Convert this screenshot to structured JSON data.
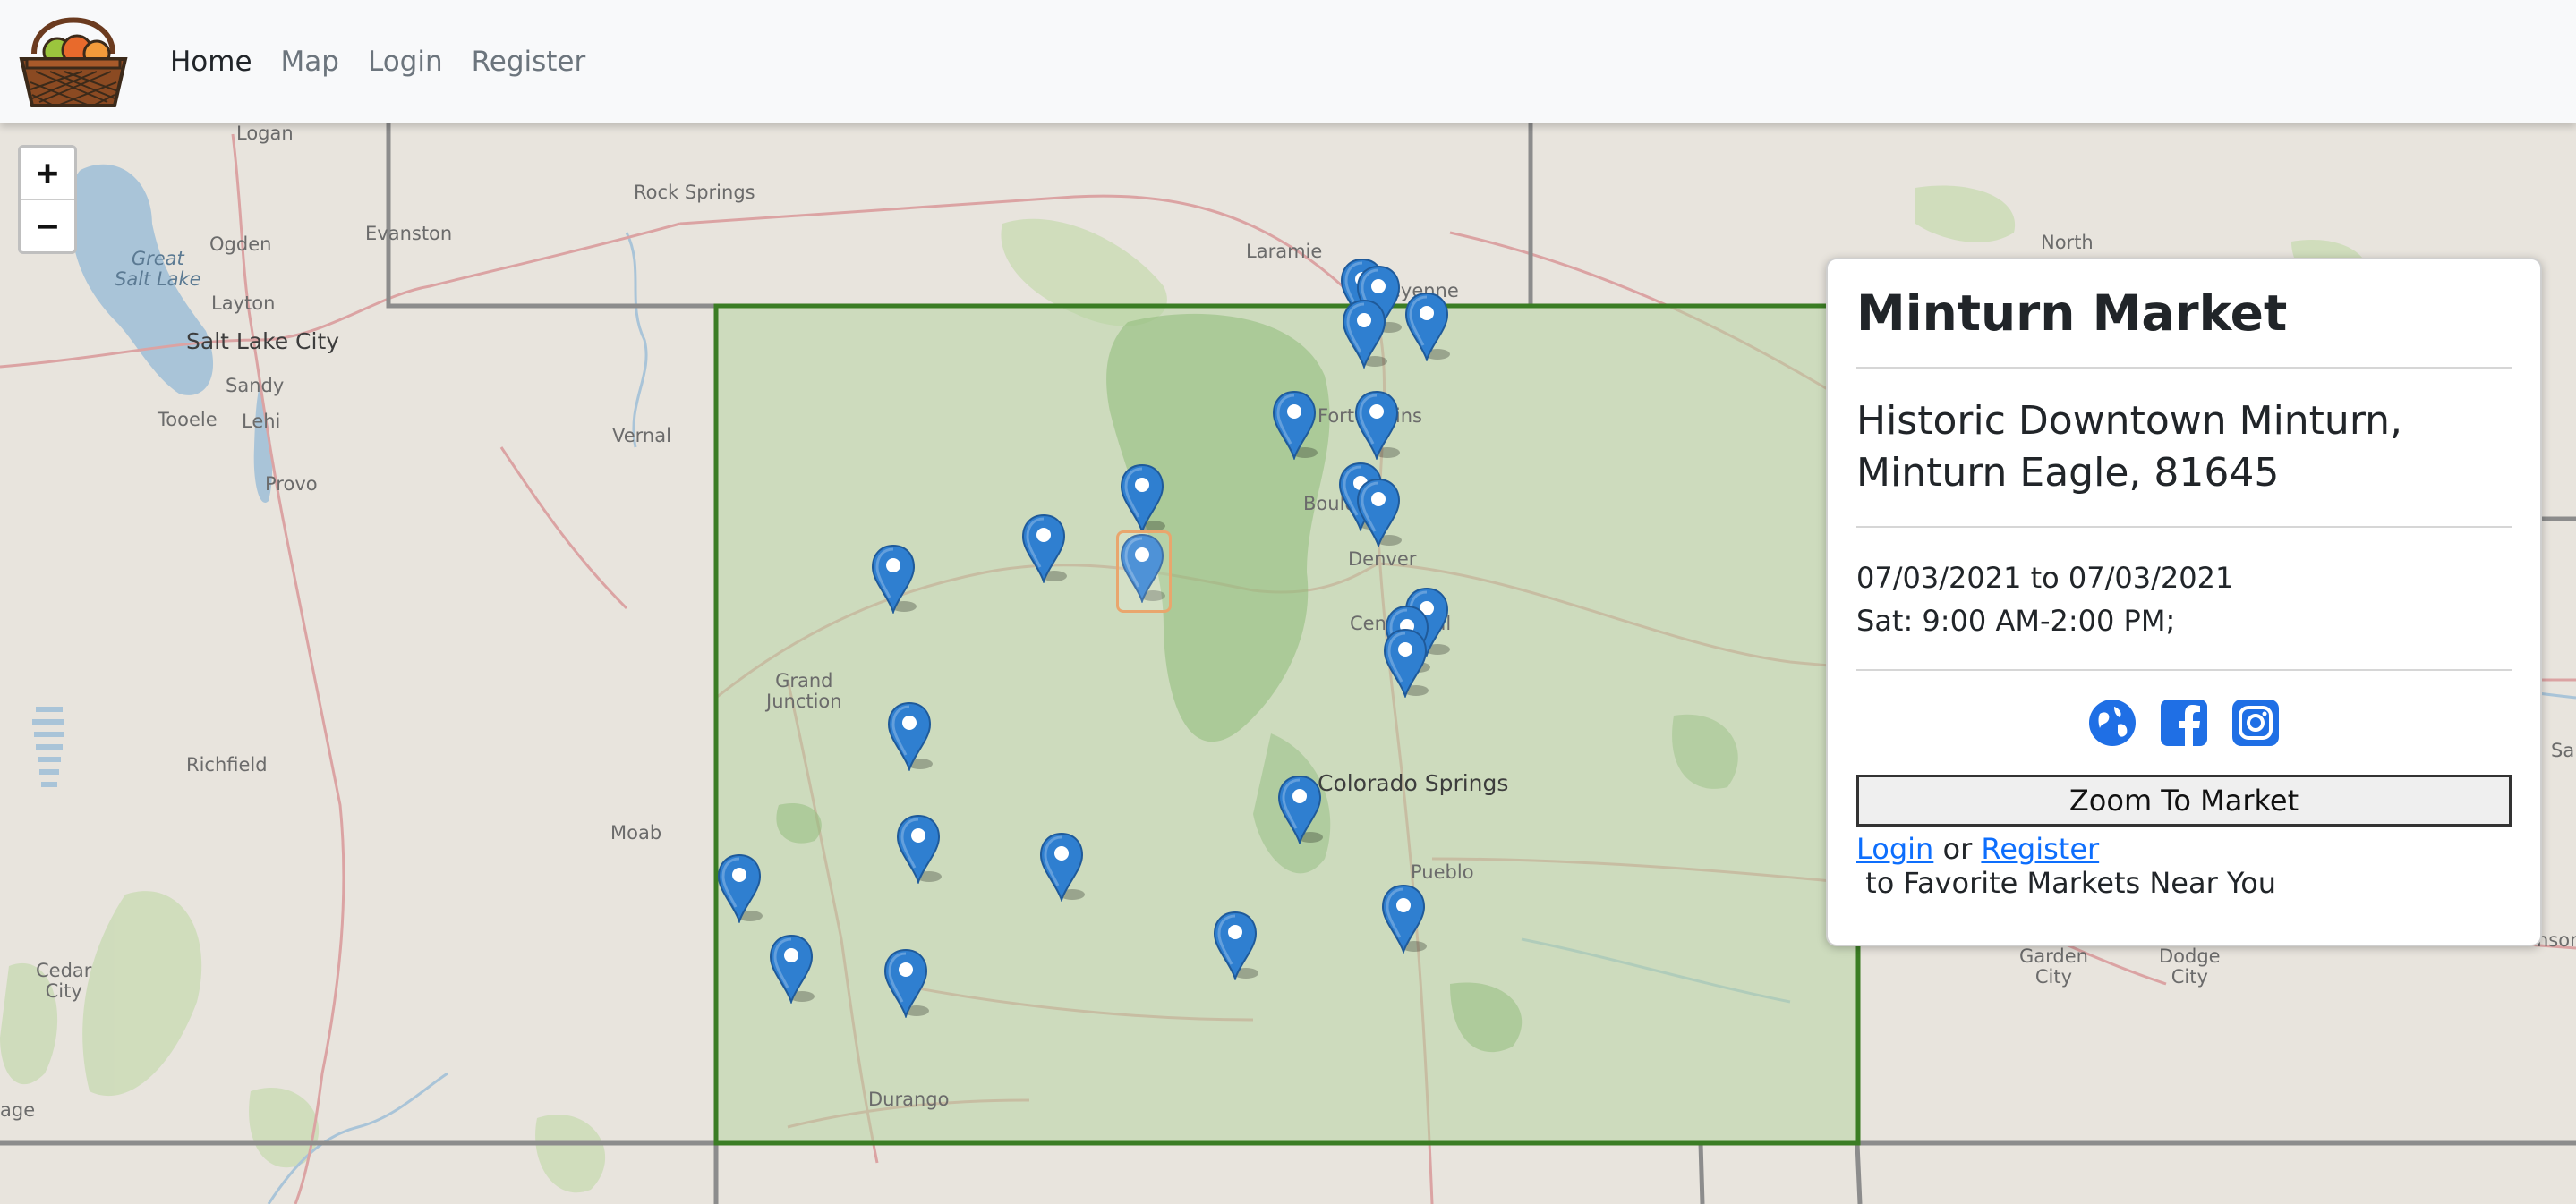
{
  "navbar": {
    "logo_alt": "fruit-basket-logo",
    "links": [
      {
        "label": "Home",
        "active": true
      },
      {
        "label": "Map",
        "active": false
      },
      {
        "label": "Login",
        "active": false
      },
      {
        "label": "Register",
        "active": false
      }
    ]
  },
  "map": {
    "zoom_in": "+",
    "zoom_out": "−",
    "places": {
      "logan": "Logan",
      "ogden": "Ogden",
      "great_salt_lake": "Great\nSalt Lake",
      "layton": "Layton",
      "salt_lake_city": "Salt Lake City",
      "sandy": "Sandy",
      "tooele": "Tooele",
      "lehi": "Lehi",
      "provo": "Provo",
      "evanston": "Evanston",
      "rock_springs": "Rock Springs",
      "laramie": "Laramie",
      "cheyenne": "Cheyenne",
      "north": "North",
      "vernal": "Vernal",
      "fort_collins": "Fort Collins",
      "boulder": "Boulder",
      "denver": "Denver",
      "centennial": "Centennial",
      "grand_junction": "Grand\nJunction",
      "richfield": "Richfield",
      "moab": "Moab",
      "colorado_springs": "Colorado Springs",
      "pueblo": "Pueblo",
      "cedar_city": "Cedar\nCity",
      "durango": "Durango",
      "garden_city": "Garden\nCity",
      "dodge_city": "Dodge\nCity",
      "age": "age",
      "sal": "Sal",
      "nson": "nson"
    },
    "marker_count": 29,
    "selected_marker": "Minturn Market",
    "colors": {
      "marker": "#2f7fd0",
      "colorado_fill": "#b7d3a2",
      "colorado_border": "#3b7d24",
      "selected_outline": "#e9a66d"
    }
  },
  "panel": {
    "title": "Minturn Market",
    "address_line1": "Historic Downtown Minturn,",
    "address_line2": "Minturn Eagle, 81645",
    "dates": "07/03/2021 to 07/03/2021",
    "hours": "Sat: 9:00 AM-2:00 PM;",
    "icons": [
      "website-globe-icon",
      "facebook-icon",
      "instagram-icon"
    ],
    "zoom_button": "Zoom To Market",
    "login_link": "Login",
    "or_text": " or ",
    "register_link": "Register",
    "cta_suffix": " to Favorite Markets Near You"
  }
}
